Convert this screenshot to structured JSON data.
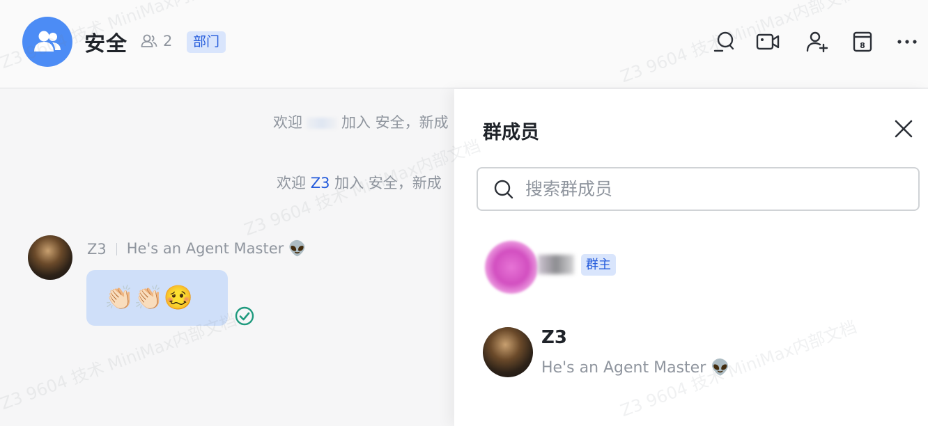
{
  "header": {
    "group_name": "安全",
    "member_count": "2",
    "dept_badge": "部门",
    "icons": [
      "search-icon",
      "video-call-icon",
      "add-member-icon",
      "calendar-icon",
      "more-icon"
    ],
    "calendar_day": "8"
  },
  "chat": {
    "system_messages": [
      {
        "prefix": "欢迎",
        "name": "",
        "suffix": "加入 安全，新成"
      },
      {
        "prefix": "欢迎",
        "name": "Z3",
        "suffix": "加入 安全，新成"
      }
    ],
    "message": {
      "sender": "Z3",
      "signature": "He's an Agent Master 👽",
      "content": "👏🏻👏🏻🥴",
      "status": "read"
    }
  },
  "panel": {
    "title": "群成员",
    "search_placeholder": "搜索群成员",
    "members": [
      {
        "name": "",
        "role_badge": "群主"
      },
      {
        "name": "Z3",
        "signature": "He's an Agent Master 👽"
      }
    ]
  },
  "watermark": "Z3 9604 技术 MiniMax内部文档",
  "colors": {
    "accent": "#245bdb",
    "avatar_blue": "#4c8cf5",
    "bubble": "#cfdff9",
    "badge_bg": "#d9e5fc",
    "check_green": "#1f9a7e"
  }
}
